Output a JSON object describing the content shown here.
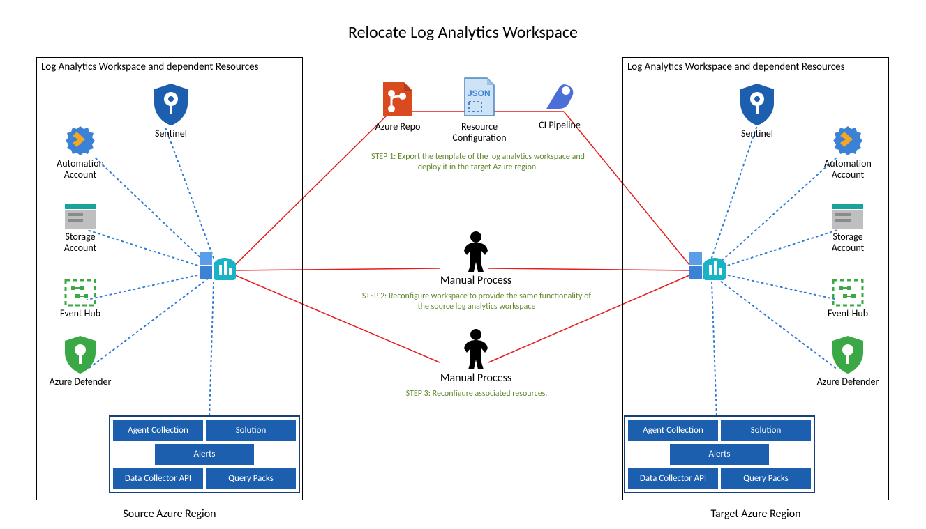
{
  "title": "Relocate Log Analytics Workspace",
  "panelHeader": "Log Analytics Workspace and dependent Resources",
  "sourceCaption": "Source Azure Region",
  "targetCaption": "Target Azure Region",
  "resources": {
    "sentinel": "Sentinel",
    "automation": "Automation Account",
    "storage": "Storage Account",
    "eventhub": "Event Hub",
    "defender": "Azure Defender"
  },
  "gridLabels": {
    "agent": "Agent Collection",
    "solution": "Solution",
    "alerts": "Alerts",
    "collector": "Data Collector API",
    "query": "Query Packs"
  },
  "center": {
    "repo": "Azure Repo",
    "resourceConfig": "Resource Configuration",
    "pipeline": "CI Pipeline",
    "manual": "Manual Process"
  },
  "steps": {
    "s1": "STEP 1: Export the template of the log analytics workspace and deploy it in the target Azure region.",
    "s2": "STEP 2: Reconfigure workspace to provide the same functionality of the source log analytics workspace",
    "s3": "STEP 3: Reconfigure associated resources."
  }
}
